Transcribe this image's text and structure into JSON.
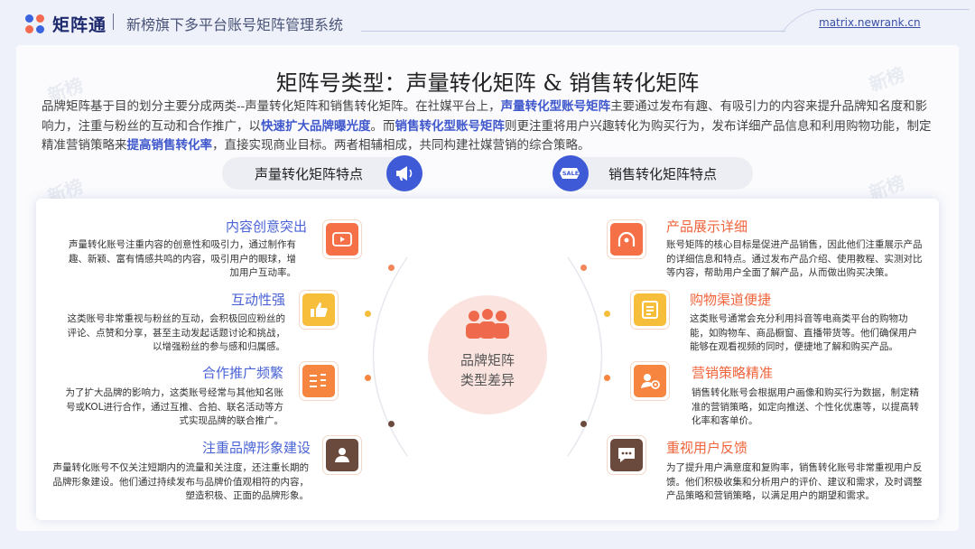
{
  "header": {
    "logo_text": "矩阵通",
    "title": "新榜旗下多平台账号矩阵管理系统",
    "url": "matrix.newrank.cn"
  },
  "watermark_text": "新榜",
  "title": "矩阵号类型：声量转化矩阵 & 销售转化矩阵",
  "intro": {
    "p1": "品牌矩阵基于目的划分主要分成两类--声量转化矩阵和销售转化矩阵。在社媒平台上，",
    "h1": "声量转化型账号矩阵",
    "p2": "主要通过发布有趣、有吸引力的内容来提升品牌知名度和影响力，注重与粉丝的互动和合作推广，以",
    "h2": "快速扩大品牌曝光度",
    "p3": "。而",
    "h3": "销售转化型账号矩阵",
    "p4": "则更注重将用户兴趣转化为购买行为，发布详细产品信息和利用购物功能，制定精准营销策略来",
    "h4": "提高销售转化率",
    "p5": "，直接实现商业目标。两者相辅相成，共同构建社媒营销的综合策略。"
  },
  "pills": {
    "left": "声量转化矩阵特点",
    "right": "销售转化矩阵特点",
    "right_icon_text": "SALE"
  },
  "center": {
    "line1": "品牌矩阵",
    "line2": "类型差异"
  },
  "left_items": [
    {
      "title": "内容创意突出",
      "desc": "声量转化账号注重内容的创意性和吸引力，通过制作有趣、新颖、富有情感共鸣的内容，吸引用户的眼球，增加用户互动率。",
      "icon": "video-play-icon",
      "color": "#f56f47"
    },
    {
      "title": "互动性强",
      "desc": "这类账号非常重视与粉丝的互动，会积极回应粉丝的评论、点赞和分享，甚至主动发起话题讨论和挑战，以增强粉丝的参与感和归属感。",
      "icon": "thumbs-up-icon",
      "color": "#f6be3b"
    },
    {
      "title": "合作推广频繁",
      "desc": "为了扩大品牌的影响力，这类账号经常与其他知名账号或KOL进行合作，通过互推、合拍、联名活动等方式实现品牌的联合推广。",
      "icon": "ranking-list-icon",
      "color": "#f5853f"
    },
    {
      "title": "注重品牌形象建设",
      "desc": "声量转化账号不仅关注短期内的流量和关注度，还注重长期的品牌形象建设。他们通过持续发布与品牌价值观相符的内容，塑造积极、正面的品牌形象。",
      "icon": "user-hand-icon",
      "color": "#6b4a3e"
    }
  ],
  "right_items": [
    {
      "title": "产品展示详细",
      "desc": "账号矩阵的核心目标是促进产品销售，因此他们注重展示产品的详细信息和特点。通过发布产品介绍、使用教程、实测对比等内容，帮助用户全面了解产品，从而做出购买决策。",
      "icon": "film-reel-icon",
      "color": "#f56f47"
    },
    {
      "title": "购物渠道便捷",
      "desc": "这类账号通常会充分利用抖音等电商类平台的购物功能，如购物车、商品橱窗、直播带货等。他们确保用户能够在观看视频的同时，便捷地了解和购买产品。",
      "icon": "shopping-list-icon",
      "color": "#f6be3b"
    },
    {
      "title": "营销策略精准",
      "desc": "销售转化账号会根据用户画像和购买行为数据，制定精准的营销策略，如定向推送、个性化优惠等，以提高转化率和客单价。",
      "icon": "user-target-icon",
      "color": "#f5853f"
    },
    {
      "title": "重视用户反馈",
      "desc": "为了提升用户满意度和复购率，销售转化账号非常重视用户反馈。他们积极收集和分析用户的评价、建议和需求，及时调整产品策略和营销策略，以满足用户的期望和需求。",
      "icon": "chat-bubble-icon",
      "color": "#6b4a3e"
    }
  ]
}
